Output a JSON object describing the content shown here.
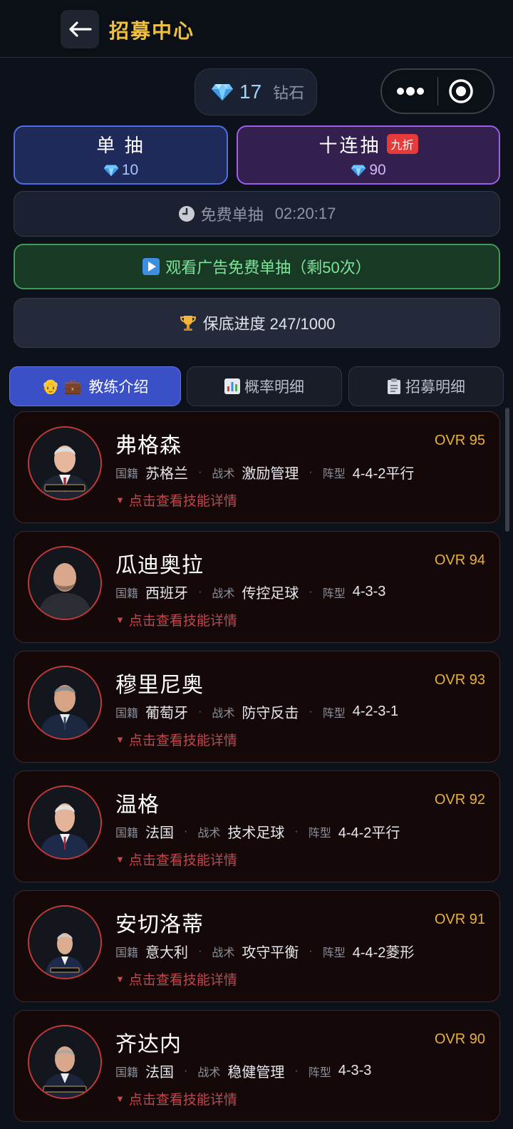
{
  "header": {
    "title": "招募中心"
  },
  "currency": {
    "amount": "17",
    "unit": "钻石"
  },
  "draw": {
    "single": {
      "label": "单 抽",
      "cost": "10"
    },
    "ten": {
      "label": "十连抽",
      "badge": "九折",
      "cost": "90"
    }
  },
  "free": {
    "label": "免费单抽",
    "timer": "02:20:17"
  },
  "ad": {
    "label": "观看广告免费单抽（剩50次）"
  },
  "pity": {
    "label": "保底进度 247/1000"
  },
  "tabs": [
    {
      "label": "教练介绍",
      "active": true
    },
    {
      "label": "概率明细",
      "active": false
    },
    {
      "label": "招募明细",
      "active": false
    }
  ],
  "labels": {
    "nation": "国籍",
    "tactic": "战术",
    "formation": "阵型",
    "detail": "点击查看技能详情"
  },
  "coaches": [
    {
      "name": "弗格森",
      "ovr": "OVR 95",
      "nation": "苏格兰",
      "tactic": "激励管理",
      "formation": "4-4-2平行"
    },
    {
      "name": "瓜迪奥拉",
      "ovr": "OVR 94",
      "nation": "西班牙",
      "tactic": "传控足球",
      "formation": "4-3-3"
    },
    {
      "name": "穆里尼奥",
      "ovr": "OVR 93",
      "nation": "葡萄牙",
      "tactic": "防守反击",
      "formation": "4-2-3-1"
    },
    {
      "name": "温格",
      "ovr": "OVR 92",
      "nation": "法国",
      "tactic": "技术足球",
      "formation": "4-4-2平行"
    },
    {
      "name": "安切洛蒂",
      "ovr": "OVR 91",
      "nation": "意大利",
      "tactic": "攻守平衡",
      "formation": "4-4-2菱形"
    },
    {
      "name": "齐达内",
      "ovr": "OVR 90",
      "nation": "法国",
      "tactic": "稳健管理",
      "formation": "4-3-3"
    }
  ],
  "colors": {
    "accent": "#f0c040",
    "single_border": "#4f6ee6",
    "ten_border": "#9b5fe8",
    "ad_border": "#3f9a58",
    "card_border": "#4a2226",
    "ovr": "#e8b23a"
  }
}
